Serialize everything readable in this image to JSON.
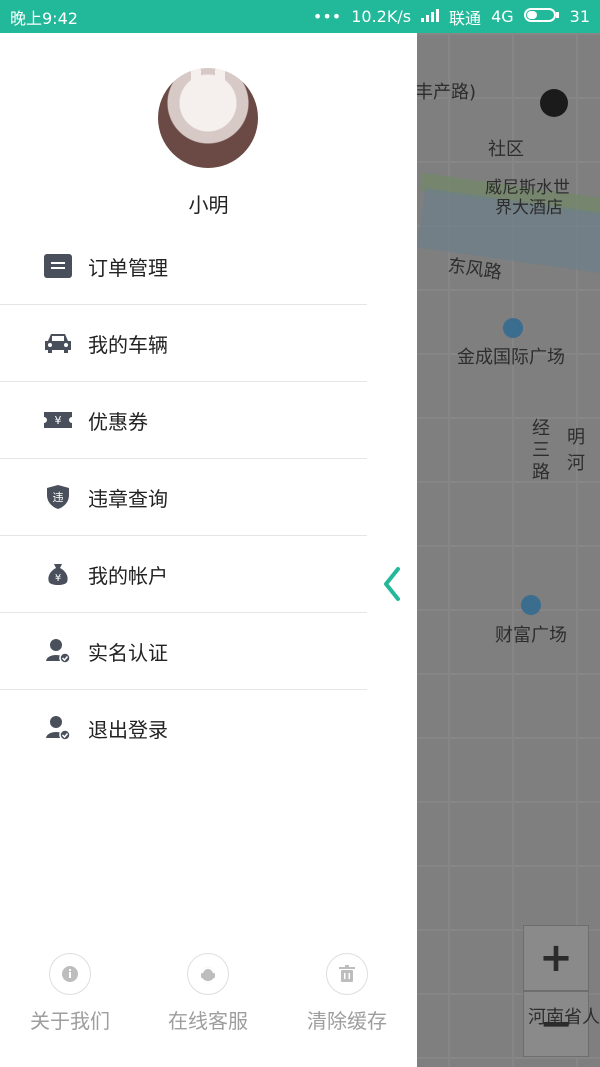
{
  "status_bar": {
    "time": "晚上9:42",
    "dots": "•••",
    "speed": "10.2K/s",
    "carrier": "联通",
    "network": "4G",
    "battery": "31"
  },
  "map": {
    "labels": {
      "top_partial": "丰产路)",
      "community": "社区",
      "hotel_line1": "威尼斯水世",
      "hotel_line2": "界大酒店",
      "east_wind_road": "东风路",
      "plaza": "金成国际广场",
      "jing3": "经三路",
      "ming_partial": "明河",
      "caifu": "财富广场",
      "henan": "河南省人"
    },
    "zoom_in": "+",
    "zoom_out": "−"
  },
  "drawer": {
    "username": "小明",
    "menu": [
      {
        "label": "订单管理",
        "icon": "order-icon"
      },
      {
        "label": "我的车辆",
        "icon": "car-icon"
      },
      {
        "label": "优惠券",
        "icon": "coupon-icon"
      },
      {
        "label": "违章查询",
        "icon": "violation-shield-icon"
      },
      {
        "label": "我的帐户",
        "icon": "wallet-bag-icon"
      },
      {
        "label": "实名认证",
        "icon": "user-verify-icon"
      },
      {
        "label": "退出登录",
        "icon": "user-logout-icon"
      }
    ],
    "bottom": [
      {
        "label": "关于我们",
        "icon": "info-icon"
      },
      {
        "label": "在线客服",
        "icon": "support-icon"
      },
      {
        "label": "清除缓存",
        "icon": "trash-icon"
      }
    ]
  },
  "colors": {
    "accent": "#21b99a",
    "icon": "#4a4f5c"
  }
}
